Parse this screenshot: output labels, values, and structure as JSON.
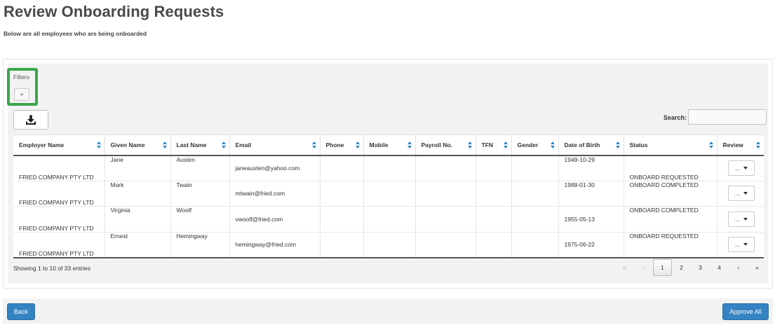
{
  "header": {
    "title": "Review Onboarding Requests",
    "subtitle": "Below are all employees who are being onboarded"
  },
  "filters": {
    "label": "Filters",
    "toggle_label": "+"
  },
  "toolbar": {
    "download_icon": "download-icon",
    "search_label": "Search:",
    "search_value": ""
  },
  "table": {
    "columns": [
      "Employer Name",
      "Given Name",
      "Last Name",
      "Email",
      "Phone",
      "Mobile",
      "Payroll No.",
      "TFN",
      "Gender",
      "Date of Birth",
      "Status",
      "Review"
    ],
    "rows": [
      {
        "employer": "FRIED COMPANY PTY LTD",
        "given": "Jane",
        "last": "Austen",
        "email": "janeausten@yahoo.com",
        "phone": "",
        "mobile": "",
        "payroll": "",
        "tfn": "",
        "gender": "",
        "dob": "1949-10-29",
        "status": "ONBOARD REQUESTED",
        "review": "..."
      },
      {
        "employer": "FRIED COMPANY PTY LTD",
        "given": "Mark",
        "last": "Twain",
        "email": "mtwain@fried.com",
        "phone": "",
        "mobile": "",
        "payroll": "",
        "tfn": "",
        "gender": "",
        "dob": "1988-01-30",
        "status": "ONBOARD COMPLETED",
        "review": "..."
      },
      {
        "employer": "FRIED COMPANY PTY LTD",
        "given": "Virginia",
        "last": "Woolf",
        "email": "vwoolf@fried.com",
        "phone": "",
        "mobile": "",
        "payroll": "",
        "tfn": "",
        "gender": "",
        "dob": "1955-05-13",
        "status": "ONBOARD COMPLETED",
        "review": "..."
      },
      {
        "employer": "FRIED COMPANY PTY LTD",
        "given": "Ernest",
        "last": "Hemingway",
        "email": "hemingway@fried.com",
        "phone": "",
        "mobile": "",
        "payroll": "",
        "tfn": "",
        "gender": "",
        "dob": "1975-06-22",
        "status": "ONBOARD REQUESTED",
        "review": "..."
      }
    ]
  },
  "footer": {
    "showing": "Showing 1 to 10 of 33 entries",
    "pagination": {
      "first": "«",
      "prev": "‹",
      "pages": [
        "1",
        "2",
        "3",
        "4"
      ],
      "active_page": "1",
      "next": "›",
      "last": "»"
    }
  },
  "actions": {
    "back_label": "Back",
    "approve_all_label": "Approve All"
  },
  "colors": {
    "primary": "#3483c3",
    "filter_highlight": "#3aa64a",
    "sort_icon": "#2e86c9"
  }
}
